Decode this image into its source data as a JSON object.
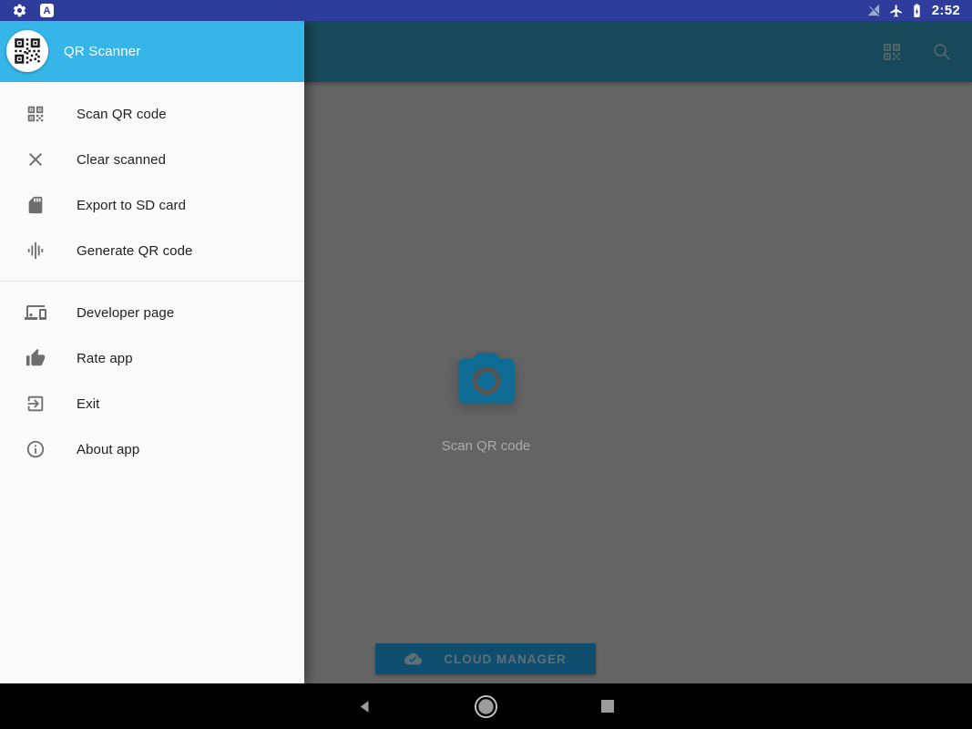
{
  "status_bar": {
    "time": "2:52",
    "letter_badge": "A"
  },
  "drawer": {
    "title": "QR Scanner",
    "groups": [
      {
        "items": [
          {
            "label": "Scan QR code"
          },
          {
            "label": "Clear scanned"
          },
          {
            "label": "Export to SD card"
          },
          {
            "label": "Generate QR code"
          }
        ]
      },
      {
        "items": [
          {
            "label": "Developer page"
          },
          {
            "label": "Rate app"
          },
          {
            "label": "Exit"
          },
          {
            "label": "About app"
          }
        ]
      }
    ]
  },
  "content": {
    "scan_label": "Scan QR code",
    "cloud_button_label": "CLOUD MANAGER"
  },
  "colors": {
    "status_bar": "#2e3d9c",
    "drawer_header": "#35b5e8",
    "app_bar_dimmed": "#17495a",
    "scrim_background": "#646464",
    "camera_icon": "#0d6b94",
    "cloud_button": "#0f4e6e",
    "drawer_background": "#fafafa",
    "drawer_text": "#1f1f1f"
  }
}
